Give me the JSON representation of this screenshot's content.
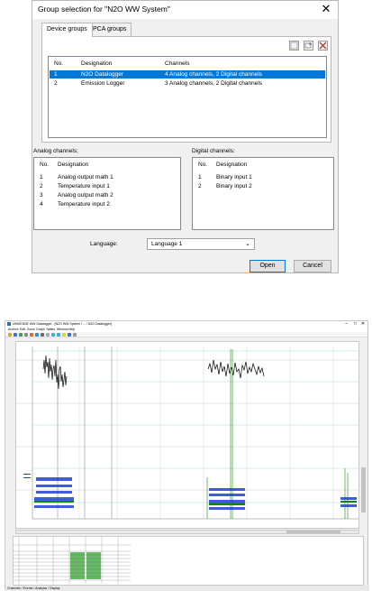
{
  "dialog": {
    "title": "Group selection for \"N2O WW System\"",
    "close": "✕",
    "tabs": [
      {
        "label": "Device groups"
      },
      {
        "label": "PCA groups"
      }
    ],
    "toolbar_icons": [
      "copy-icon",
      "settings-icon",
      "delete-icon"
    ],
    "groups_table": {
      "headers": [
        "No.",
        "Designation",
        "Channels"
      ],
      "rows": [
        {
          "no": "1",
          "designation": "N2O Datalogger",
          "channels": "4 Analog channels, 2 Digital channels"
        },
        {
          "no": "2",
          "designation": "Emission Logger",
          "channels": "3 Analog channels, 2 Digital channels"
        }
      ]
    },
    "analog_label": "Analog channels;",
    "analog_table": {
      "headers": [
        "No.",
        "Designation"
      ],
      "rows": [
        {
          "no": "1",
          "designation": "Analog output math 1"
        },
        {
          "no": "2",
          "designation": "Temperature input 1"
        },
        {
          "no": "3",
          "designation": "Analog output math 2"
        },
        {
          "no": "4",
          "designation": "Temperature input 2"
        }
      ]
    },
    "digital_label": "Digital channels:",
    "digital_table": {
      "headers": [
        "No.",
        "Designation"
      ],
      "rows": [
        {
          "no": "1",
          "designation": "Binary input 1"
        },
        {
          "no": "2",
          "designation": "Binary input 2"
        }
      ]
    },
    "language_label": "Language:",
    "language_value": "Language 1",
    "open_label": "Open",
    "cancel_label": "Cancel"
  },
  "app": {
    "title": "UNISENSE WW Datalogger - [N2O WW System / ... / N2O Datalogger]",
    "menu": [
      "Archive",
      "Edit",
      "Zoom",
      "Graph",
      "Tables",
      "Window",
      "Help"
    ],
    "win_controls": [
      "–",
      "□",
      "✕"
    ],
    "sheet_tabs": "Channels / Events / Analysis / Display"
  },
  "colors": {
    "selection": "#0078d7",
    "series_black": "#000000",
    "series_blue": "#1f3fd6",
    "series_green": "#0a8a0a"
  }
}
